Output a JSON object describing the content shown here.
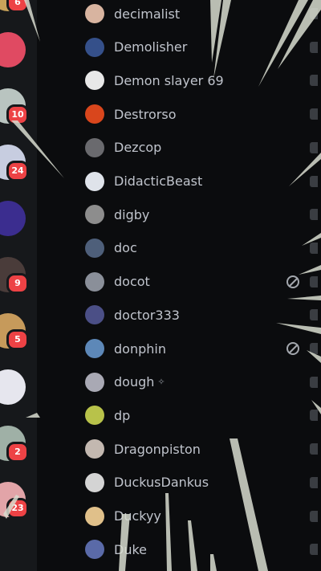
{
  "server_rail": [
    {
      "badge": "6",
      "color": "#c9a35a"
    },
    {
      "badge": "",
      "color": "#e04a62"
    },
    {
      "badge": "10",
      "color": "#b9c4c0"
    },
    {
      "badge": "24",
      "color": "#c7cde0"
    },
    {
      "badge": "",
      "color": "#3b2d8f"
    },
    {
      "badge": "9",
      "color": "#4a3c3a"
    },
    {
      "badge": "5",
      "color": "#c69a5b"
    },
    {
      "badge": "",
      "color": "#e6e6ee"
    },
    {
      "badge": "2",
      "color": "#9fb0a6"
    },
    {
      "badge": "23",
      "color": "#e2a4a8"
    }
  ],
  "members": [
    {
      "name": "decimalist",
      "avatar_color": "#d8b4a0",
      "status_icon": "none"
    },
    {
      "name": "Demolisher",
      "avatar_color": "#35508a",
      "status_icon": "none"
    },
    {
      "name": "Demon slayer 69",
      "avatar_color": "#e8e8e8",
      "status_icon": "none"
    },
    {
      "name": "Destrorso",
      "avatar_color": "#d9461c",
      "status_icon": "none"
    },
    {
      "name": "Dezcop",
      "avatar_color": "#6a6a6e",
      "status_icon": "none"
    },
    {
      "name": "DidacticBeast",
      "avatar_color": "#dfe3ea",
      "status_icon": "none"
    },
    {
      "name": "digby",
      "avatar_color": "#8d8d8d",
      "status_icon": "none"
    },
    {
      "name": "doc",
      "avatar_color": "#4e5f7a",
      "status_icon": "none"
    },
    {
      "name": "docot",
      "avatar_color": "#8a8f99",
      "status_icon": "do-not-disturb"
    },
    {
      "name": "doctor333",
      "avatar_color": "#4b4f86",
      "status_icon": "none"
    },
    {
      "name": "donphin",
      "avatar_color": "#5d88b8",
      "status_icon": "do-not-disturb"
    },
    {
      "name": "dough",
      "avatar_color": "#a9a9b4",
      "status_icon": "none"
    },
    {
      "name": "dp",
      "avatar_color": "#b8c24a",
      "status_icon": "none"
    },
    {
      "name": "Dragonpiston",
      "avatar_color": "#c3b8b0",
      "status_icon": "none"
    },
    {
      "name": "DuckusDankus",
      "avatar_color": "#d4d4d4",
      "status_icon": "none"
    },
    {
      "name": "Duckyy",
      "avatar_color": "#e0c08a",
      "status_icon": "none"
    },
    {
      "name": "Duke",
      "avatar_color": "#5a6aa8",
      "status_icon": "none"
    }
  ],
  "dough_suffix": "✧"
}
